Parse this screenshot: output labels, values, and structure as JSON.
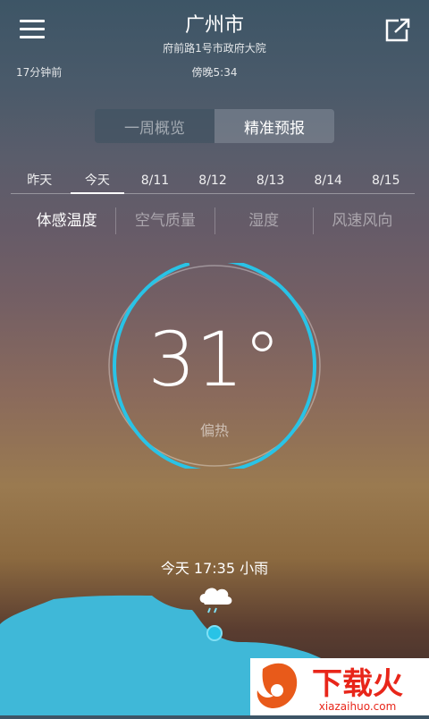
{
  "header": {
    "city": "广州市",
    "address": "府前路1号市政府大院",
    "updated": "17分钟前",
    "sunset": "傍晚5:34"
  },
  "segmented": {
    "overview": "一周概览",
    "precise": "精准预报",
    "selected": "precise"
  },
  "date_tabs": [
    {
      "label": "昨天"
    },
    {
      "label": "今天",
      "active": true
    },
    {
      "label": "8/11"
    },
    {
      "label": "8/12"
    },
    {
      "label": "8/13"
    },
    {
      "label": "8/14"
    },
    {
      "label": "8/15"
    }
  ],
  "metric_tabs": [
    {
      "label": "体感温度",
      "active": true
    },
    {
      "label": "空气质量"
    },
    {
      "label": "湿度"
    },
    {
      "label": "风速风向"
    }
  ],
  "gauge": {
    "temperature": "31°",
    "feeling": "偏热",
    "fill_fraction": 0.96
  },
  "forecast": {
    "label": "今天 17:35 小雨",
    "icon": "cloud-rain-icon"
  },
  "watermark": {
    "text": "下载火",
    "url_text": "xiazaihuo.com"
  },
  "colors": {
    "accent": "#29c3e6",
    "terrain": "#3fb8d8"
  }
}
